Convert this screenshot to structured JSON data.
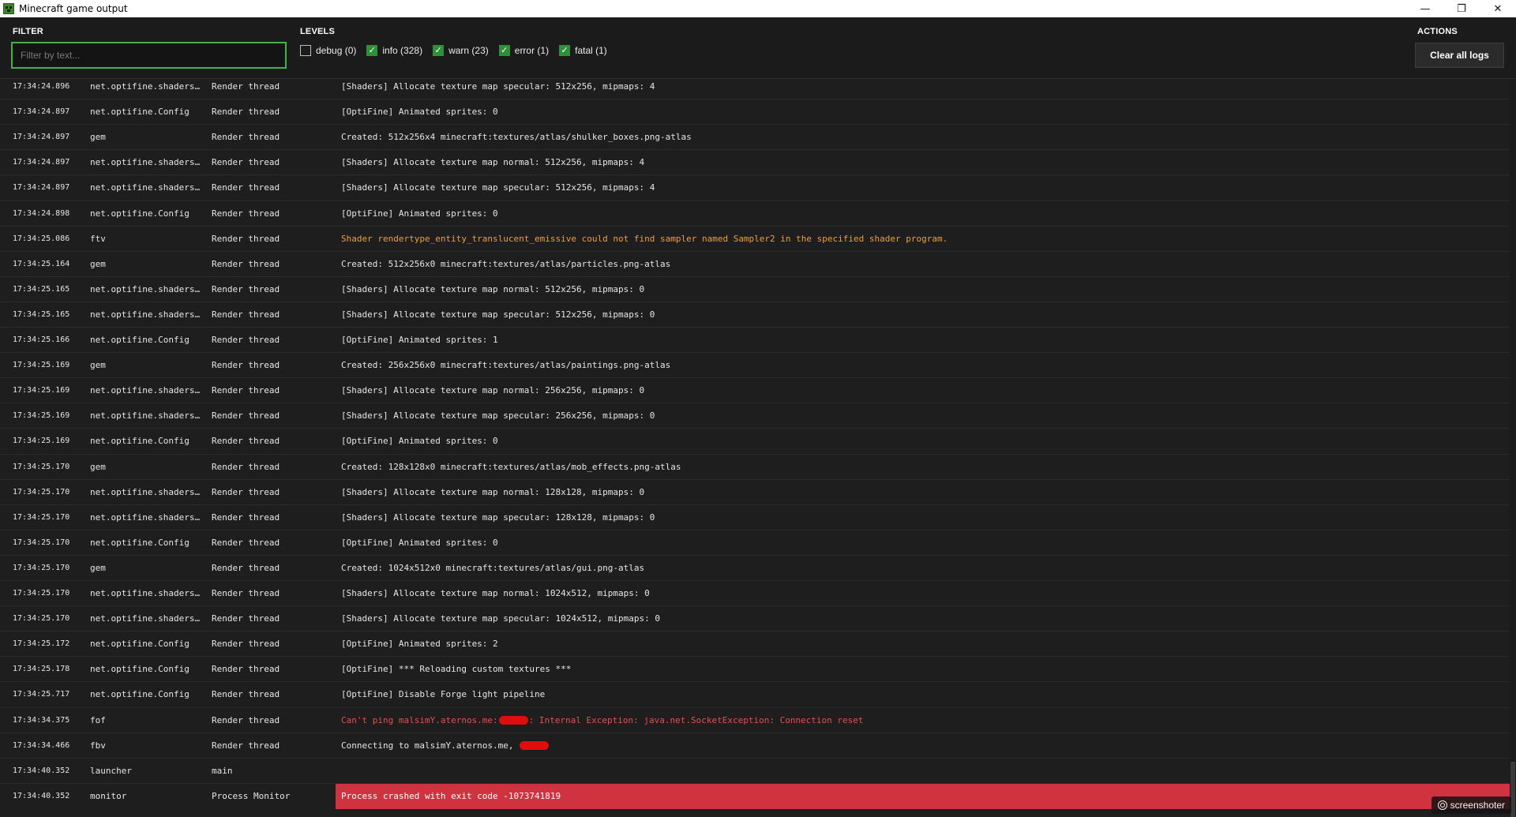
{
  "window": {
    "title": "Minecraft game output",
    "minimize": "—",
    "maximize": "❐",
    "close": "✕"
  },
  "toolbar": {
    "filter_label": "FILTER",
    "filter_placeholder": "Filter by text...",
    "filter_value": "",
    "levels_label": "LEVELS",
    "levels": [
      {
        "label": "debug (0)",
        "checked": false
      },
      {
        "label": "info (328)",
        "checked": true
      },
      {
        "label": "warn (23)",
        "checked": true
      },
      {
        "label": "error (1)",
        "checked": true
      },
      {
        "label": "fatal (1)",
        "checked": true
      }
    ],
    "actions_label": "ACTIONS",
    "clear_label": "Clear all logs"
  },
  "logs": [
    {
      "time": "17:34:24.896",
      "logger": "net.optifine.shaders...",
      "thread": "Render thread",
      "level": "info",
      "message": "[Shaders] Allocate texture map specular: 512x256, mipmaps: 4"
    },
    {
      "time": "17:34:24.897",
      "logger": "net.optifine.Config",
      "thread": "Render thread",
      "level": "info",
      "message": "[OptiFine] Animated sprites: 0"
    },
    {
      "time": "17:34:24.897",
      "logger": "gem",
      "thread": "Render thread",
      "level": "info",
      "message": "Created: 512x256x4 minecraft:textures/atlas/shulker_boxes.png-atlas"
    },
    {
      "time": "17:34:24.897",
      "logger": "net.optifine.shaders...",
      "thread": "Render thread",
      "level": "info",
      "message": "[Shaders] Allocate texture map normal: 512x256, mipmaps: 4"
    },
    {
      "time": "17:34:24.897",
      "logger": "net.optifine.shaders...",
      "thread": "Render thread",
      "level": "info",
      "message": "[Shaders] Allocate texture map specular: 512x256, mipmaps: 4"
    },
    {
      "time": "17:34:24.898",
      "logger": "net.optifine.Config",
      "thread": "Render thread",
      "level": "info",
      "message": "[OptiFine] Animated sprites: 0"
    },
    {
      "time": "17:34:25.086",
      "logger": "ftv",
      "thread": "Render thread",
      "level": "warn",
      "message": "Shader rendertype_entity_translucent_emissive could not find sampler named Sampler2 in the specified shader program."
    },
    {
      "time": "17:34:25.164",
      "logger": "gem",
      "thread": "Render thread",
      "level": "info",
      "message": "Created: 512x256x0 minecraft:textures/atlas/particles.png-atlas"
    },
    {
      "time": "17:34:25.165",
      "logger": "net.optifine.shaders...",
      "thread": "Render thread",
      "level": "info",
      "message": "[Shaders] Allocate texture map normal: 512x256, mipmaps: 0"
    },
    {
      "time": "17:34:25.165",
      "logger": "net.optifine.shaders...",
      "thread": "Render thread",
      "level": "info",
      "message": "[Shaders] Allocate texture map specular: 512x256, mipmaps: 0"
    },
    {
      "time": "17:34:25.166",
      "logger": "net.optifine.Config",
      "thread": "Render thread",
      "level": "info",
      "message": "[OptiFine] Animated sprites: 1"
    },
    {
      "time": "17:34:25.169",
      "logger": "gem",
      "thread": "Render thread",
      "level": "info",
      "message": "Created: 256x256x0 minecraft:textures/atlas/paintings.png-atlas"
    },
    {
      "time": "17:34:25.169",
      "logger": "net.optifine.shaders...",
      "thread": "Render thread",
      "level": "info",
      "message": "[Shaders] Allocate texture map normal: 256x256, mipmaps: 0"
    },
    {
      "time": "17:34:25.169",
      "logger": "net.optifine.shaders...",
      "thread": "Render thread",
      "level": "info",
      "message": "[Shaders] Allocate texture map specular: 256x256, mipmaps: 0"
    },
    {
      "time": "17:34:25.169",
      "logger": "net.optifine.Config",
      "thread": "Render thread",
      "level": "info",
      "message": "[OptiFine] Animated sprites: 0"
    },
    {
      "time": "17:34:25.170",
      "logger": "gem",
      "thread": "Render thread",
      "level": "info",
      "message": "Created: 128x128x0 minecraft:textures/atlas/mob_effects.png-atlas"
    },
    {
      "time": "17:34:25.170",
      "logger": "net.optifine.shaders...",
      "thread": "Render thread",
      "level": "info",
      "message": "[Shaders] Allocate texture map normal: 128x128, mipmaps: 0"
    },
    {
      "time": "17:34:25.170",
      "logger": "net.optifine.shaders...",
      "thread": "Render thread",
      "level": "info",
      "message": "[Shaders] Allocate texture map specular: 128x128, mipmaps: 0"
    },
    {
      "time": "17:34:25.170",
      "logger": "net.optifine.Config",
      "thread": "Render thread",
      "level": "info",
      "message": "[OptiFine] Animated sprites: 0"
    },
    {
      "time": "17:34:25.170",
      "logger": "gem",
      "thread": "Render thread",
      "level": "info",
      "message": "Created: 1024x512x0 minecraft:textures/atlas/gui.png-atlas"
    },
    {
      "time": "17:34:25.170",
      "logger": "net.optifine.shaders...",
      "thread": "Render thread",
      "level": "info",
      "message": "[Shaders] Allocate texture map normal: 1024x512, mipmaps: 0"
    },
    {
      "time": "17:34:25.170",
      "logger": "net.optifine.shaders...",
      "thread": "Render thread",
      "level": "info",
      "message": "[Shaders] Allocate texture map specular: 1024x512, mipmaps: 0"
    },
    {
      "time": "17:34:25.172",
      "logger": "net.optifine.Config",
      "thread": "Render thread",
      "level": "info",
      "message": "[OptiFine] Animated sprites: 2"
    },
    {
      "time": "17:34:25.178",
      "logger": "net.optifine.Config",
      "thread": "Render thread",
      "level": "info",
      "message": "[OptiFine] *** Reloading custom textures ***"
    },
    {
      "time": "17:34:25.717",
      "logger": "net.optifine.Config",
      "thread": "Render thread",
      "level": "info",
      "message": "[OptiFine] Disable Forge light pipeline"
    },
    {
      "time": "17:34:34.375",
      "logger": "fof",
      "thread": "Render thread",
      "level": "error",
      "message": "Can't ping malsimY.aternos.me:",
      "redacted": true,
      "message_after": ": Internal Exception: java.net.SocketException: Connection reset"
    },
    {
      "time": "17:34:34.466",
      "logger": "fbv",
      "thread": "Render thread",
      "level": "info",
      "message": "Connecting to malsimY.aternos.me, ",
      "redacted": true,
      "message_after": ""
    },
    {
      "time": "17:34:40.352",
      "logger": "launcher",
      "thread": "main",
      "level": "info",
      "message": ""
    },
    {
      "time": "17:34:40.352",
      "logger": "monitor",
      "thread": "Process Monitor",
      "level": "fatal",
      "message": "Process crashed with exit code -1073741819"
    }
  ],
  "watermark": {
    "text": "screenshoter",
    "icon": "at-icon"
  }
}
